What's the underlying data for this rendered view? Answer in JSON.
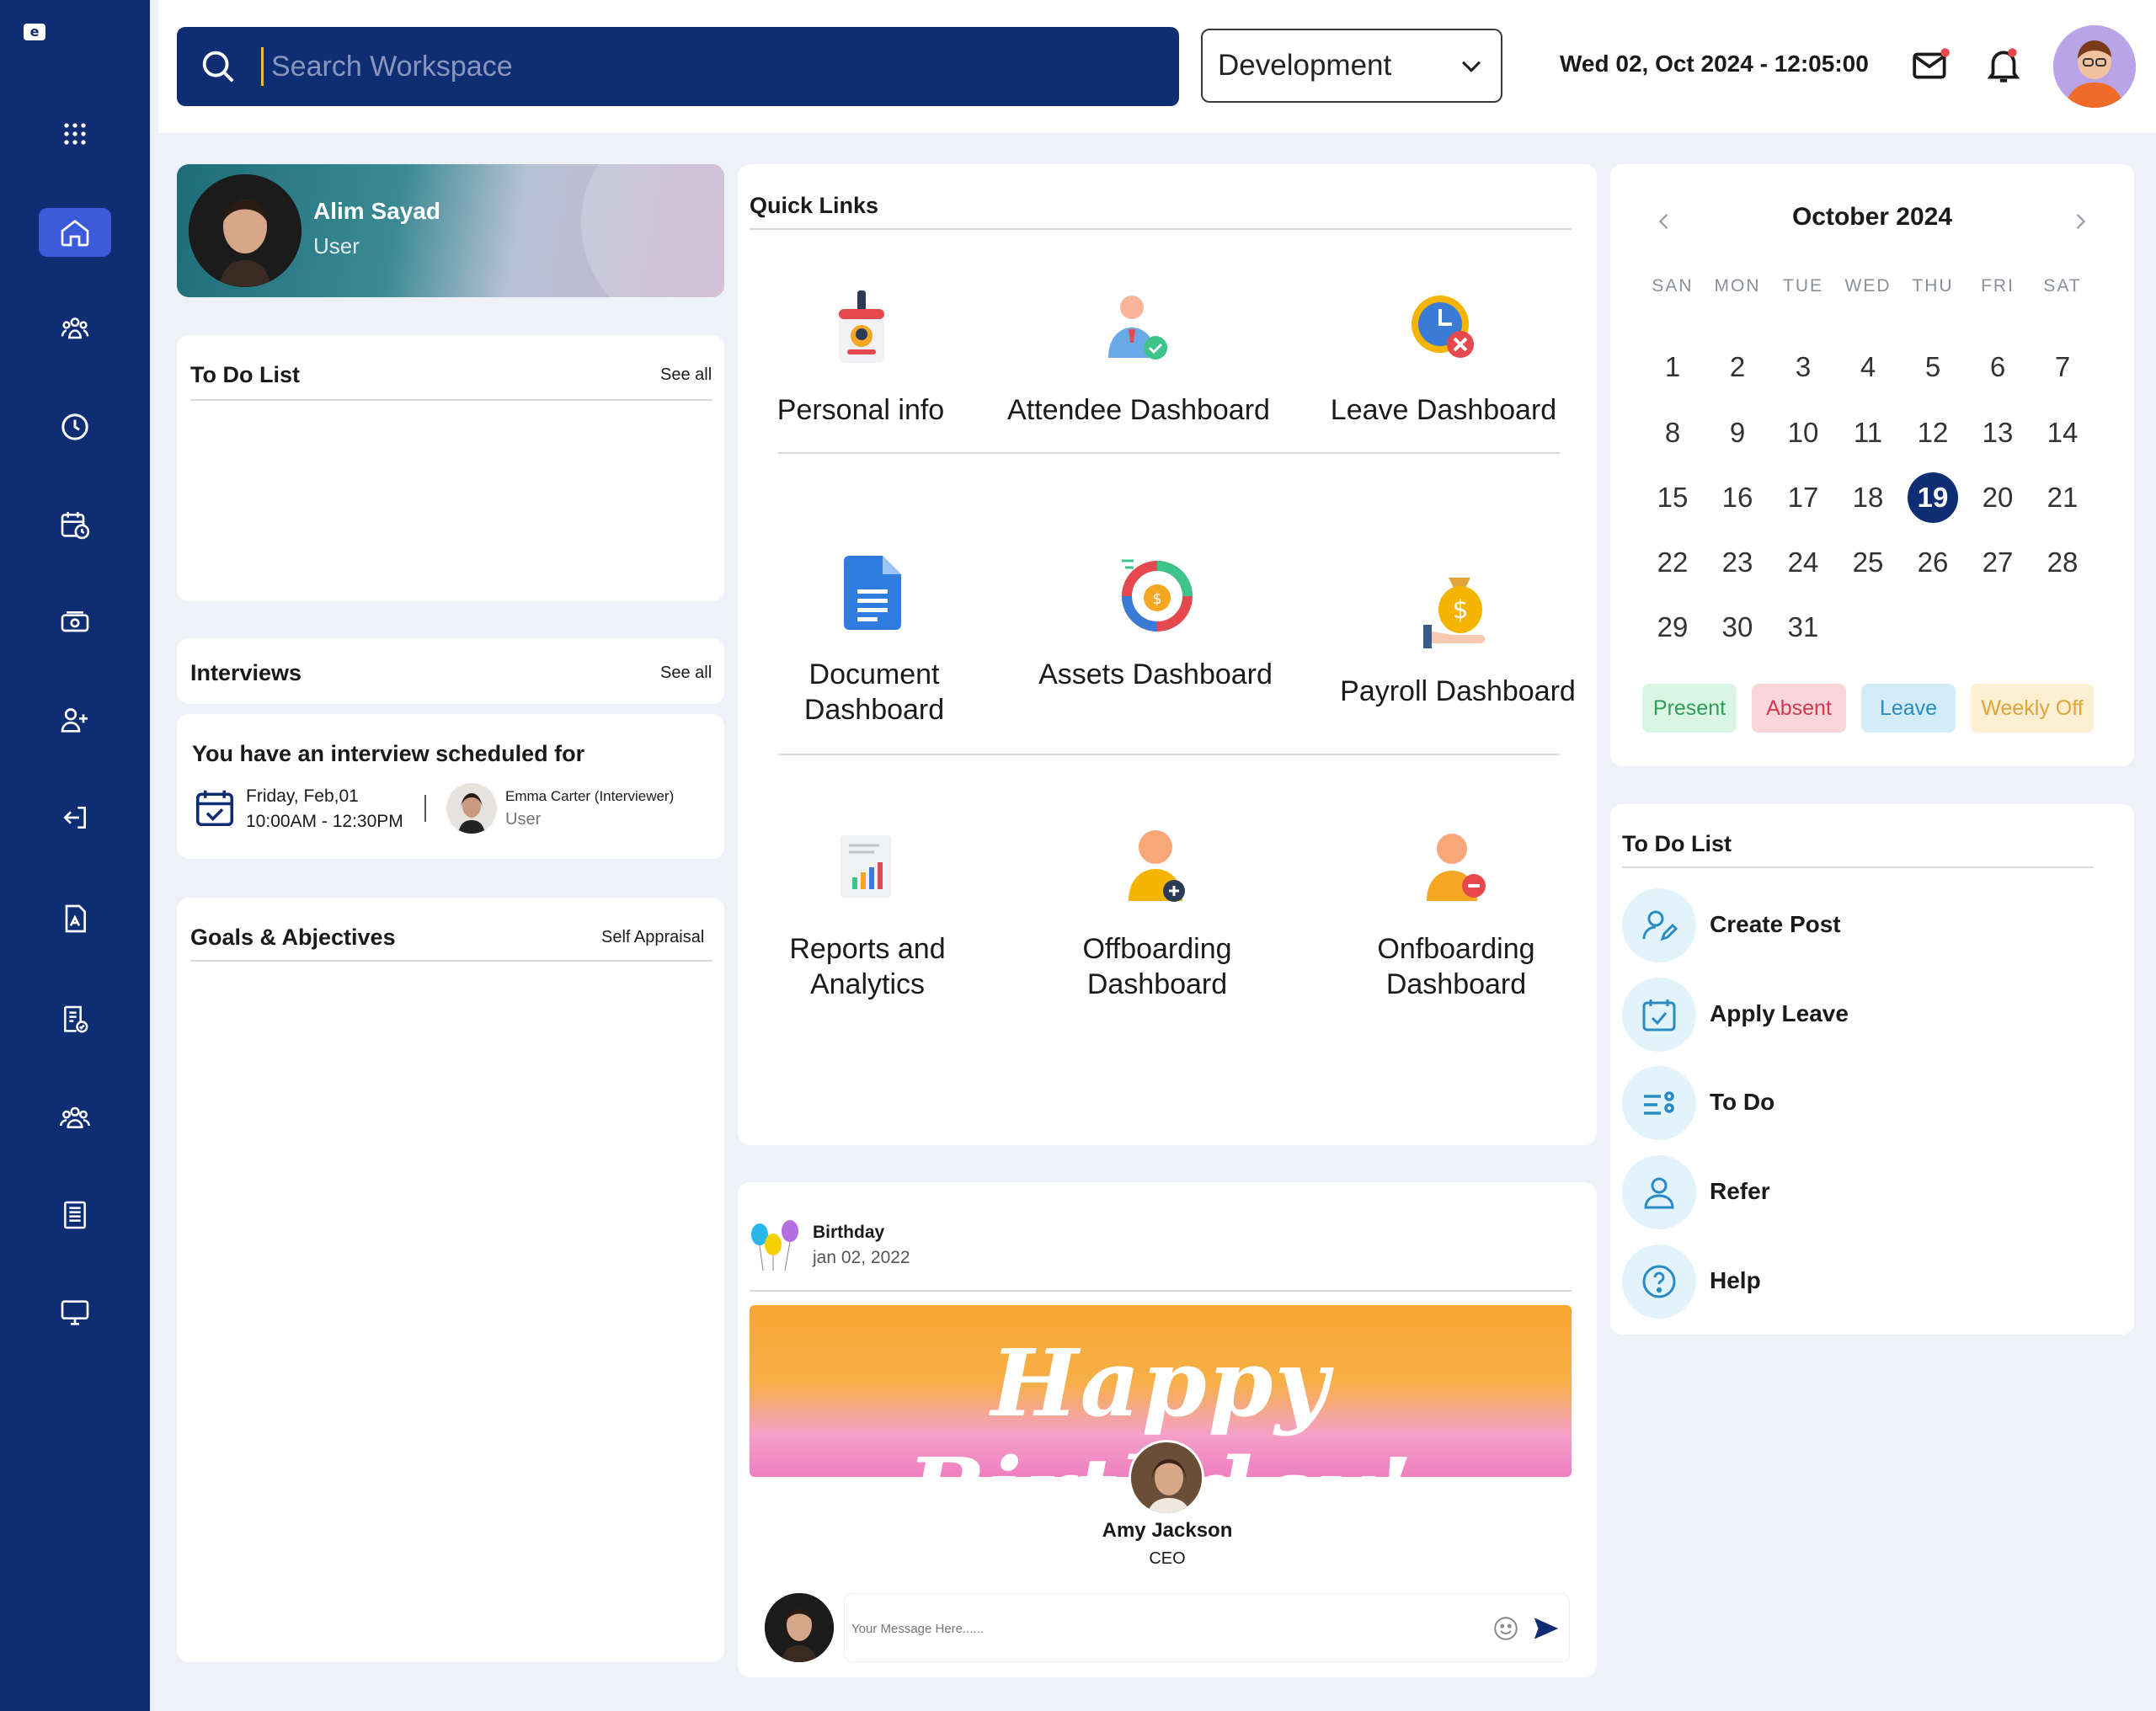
{
  "app": {
    "logo": "e"
  },
  "sidebar": {
    "items": [
      {
        "name": "apps-grid-icon"
      },
      {
        "name": "home-icon"
      },
      {
        "name": "team-icon"
      },
      {
        "name": "clock-icon"
      },
      {
        "name": "calendar-clock-icon"
      },
      {
        "name": "payroll-icon"
      },
      {
        "name": "add-user-icon"
      },
      {
        "name": "logout-icon"
      },
      {
        "name": "document-icon"
      },
      {
        "name": "checklist-icon"
      },
      {
        "name": "group-icon"
      },
      {
        "name": "report-icon"
      },
      {
        "name": "monitor-icon"
      }
    ]
  },
  "header": {
    "search_placeholder": "Search Workspace",
    "department": "Development",
    "datetime": "Wed 02, Oct 2024 - 12:05:00"
  },
  "profile": {
    "name": "Alim Sayad",
    "role": "User"
  },
  "todo_left": {
    "title": "To Do List",
    "see_all": "See all"
  },
  "interviews": {
    "title": "Interviews",
    "see_all": "See all",
    "headline": "You have an interview scheduled for",
    "date": "Friday, Feb,01",
    "time": "10:00AM - 12:30PM",
    "interviewer": "Emma Carter (Interviewer)",
    "interviewer_role": "User"
  },
  "goals": {
    "title": "Goals & Abjectives",
    "link": "Self Appraisal"
  },
  "quick_links": {
    "title": "Quick Links",
    "items": [
      {
        "label": "Personal info"
      },
      {
        "label": "Attendee Dashboard"
      },
      {
        "label": "Leave Dashboard"
      },
      {
        "label": "Document Dashboard"
      },
      {
        "label": "Assets Dashboard"
      },
      {
        "label": "Payroll Dashboard"
      },
      {
        "label": "Reports and Analytics"
      },
      {
        "label": "Offboarding Dashboard"
      },
      {
        "label": "Onfboarding Dashboard"
      }
    ]
  },
  "birthday": {
    "title": "Birthday",
    "date": "jan 02, 2022",
    "banner": "Happy Birthday!",
    "person": "Amy Jackson",
    "person_role": "CEO",
    "message_placeholder": "Your Message Here......"
  },
  "calendar": {
    "month": "October 2024",
    "weekdays": [
      "SAN",
      "MON",
      "TUE",
      "WED",
      "THU",
      "FRI",
      "SAT"
    ],
    "days": [
      "1",
      "2",
      "3",
      "4",
      "5",
      "6",
      "7",
      "8",
      "9",
      "10",
      "11",
      "12",
      "13",
      "14",
      "15",
      "16",
      "17",
      "18",
      "19",
      "20",
      "21",
      "22",
      "23",
      "24",
      "25",
      "26",
      "27",
      "28",
      "29",
      "30",
      "31"
    ],
    "today": "19",
    "legend": [
      "Present",
      "Absent",
      "Leave",
      "Weekly Off"
    ]
  },
  "todo_right": {
    "title": "To Do List",
    "items": [
      {
        "label": "Create Post"
      },
      {
        "label": "Apply Leave"
      },
      {
        "label": "To Do"
      },
      {
        "label": "Refer"
      },
      {
        "label": "Help"
      }
    ]
  },
  "colors": {
    "sidebar": "#0f2d73",
    "accent": "#3b5bdb",
    "present_bg": "#d9f5e3",
    "present_fg": "#2f9e5a",
    "absent_bg": "#f9d6da",
    "absent_fg": "#d0394f",
    "leave_bg": "#d4ecf8",
    "leave_fg": "#2a8bc4",
    "weekly_bg": "#fcefd2",
    "weekly_fg": "#e0a43a"
  }
}
